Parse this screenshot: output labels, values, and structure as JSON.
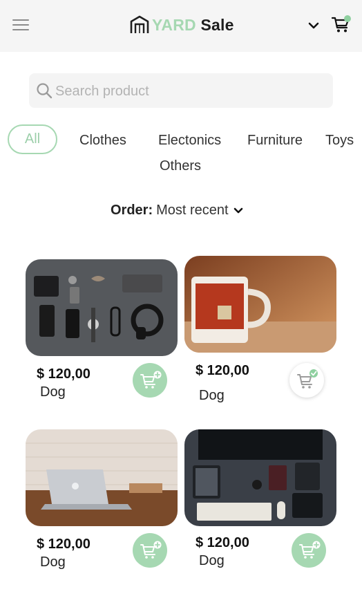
{
  "header": {
    "logo_accent": "YARD",
    "logo_dark": "Sale",
    "menu_icon": "hamburger-icon",
    "account_icon": "chevron-down-icon",
    "cart_icon": "cart-icon",
    "accent_color": "#a6d8b2"
  },
  "search": {
    "placeholder": "Search product",
    "icon": "search-icon"
  },
  "categories": {
    "all": "All",
    "clothes": "Clothes",
    "electronics": "Electonics",
    "furniture": "Furniture",
    "toys": "Toys",
    "others": "Others",
    "selected": "All"
  },
  "order": {
    "label": "Order:",
    "value": "Most recent"
  },
  "products": [
    {
      "price": "$ 120,00",
      "name": "Dog",
      "image": "flat lay of wallet, phone, watch, headphones and accessories on dark surface",
      "in_cart": false
    },
    {
      "price": "$ 120,00",
      "name": "Dog",
      "image": "red and white mug on a wooden table",
      "in_cart": true
    },
    {
      "price": "$ 120,00",
      "name": "Dog",
      "image": "laptop on a wooden desk against white brick wall",
      "in_cart": false
    },
    {
      "price": "$ 120,00",
      "name": "Dog",
      "image": "desk setup with monitor, keyboard, mouse, tablet and camera",
      "in_cart": false
    }
  ]
}
